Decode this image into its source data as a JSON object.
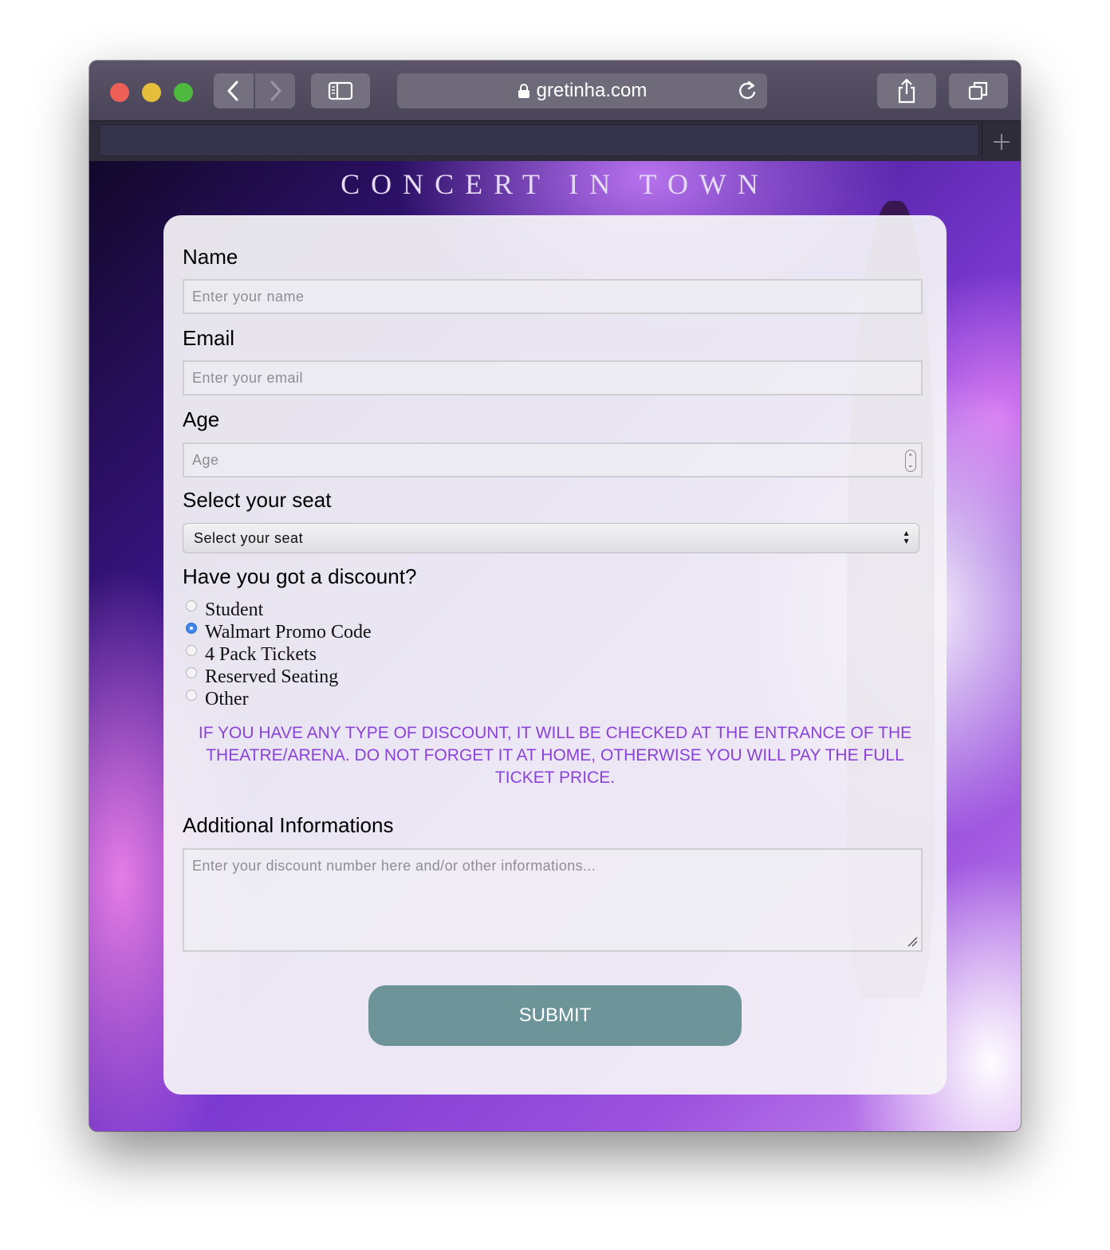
{
  "browser": {
    "url": "gretinha.com",
    "icons": [
      "back-icon",
      "forward-icon",
      "sidebar-icon",
      "lock-icon",
      "reload-icon",
      "share-icon",
      "tabs-icon",
      "new-tab-icon"
    ]
  },
  "page": {
    "title": "CONCERT IN TOWN",
    "form": {
      "name_label": "Name",
      "name_placeholder": "Enter your name",
      "email_label": "Email",
      "email_placeholder": "Enter your email",
      "age_label": "Age",
      "age_placeholder": "Age",
      "seat_label": "Select your seat",
      "seat_selected": "Select your seat",
      "discount_label": "Have you got a discount?",
      "discount_options": [
        {
          "label": "Student",
          "checked": false
        },
        {
          "label": "Walmart Promo Code",
          "checked": true
        },
        {
          "label": "4 Pack Tickets",
          "checked": false
        },
        {
          "label": "Reserved Seating",
          "checked": false
        },
        {
          "label": "Other",
          "checked": false
        }
      ],
      "notice": "IF YOU HAVE ANY TYPE OF DISCOUNT, IT WILL BE CHECKED AT THE ENTRANCE OF THE THEATRE/ARENA. DO NOT FORGET IT AT HOME, OTHERWISE YOU WILL PAY THE FULL TICKET PRICE.",
      "additional_label": "Additional Informations",
      "additional_placeholder": "Enter your discount number here and/or other informations...",
      "submit_label": "SUBMIT"
    }
  },
  "colors": {
    "notice": "#8a43d9",
    "submit": "#6d9599",
    "radio_checked": "#3f87ee"
  }
}
